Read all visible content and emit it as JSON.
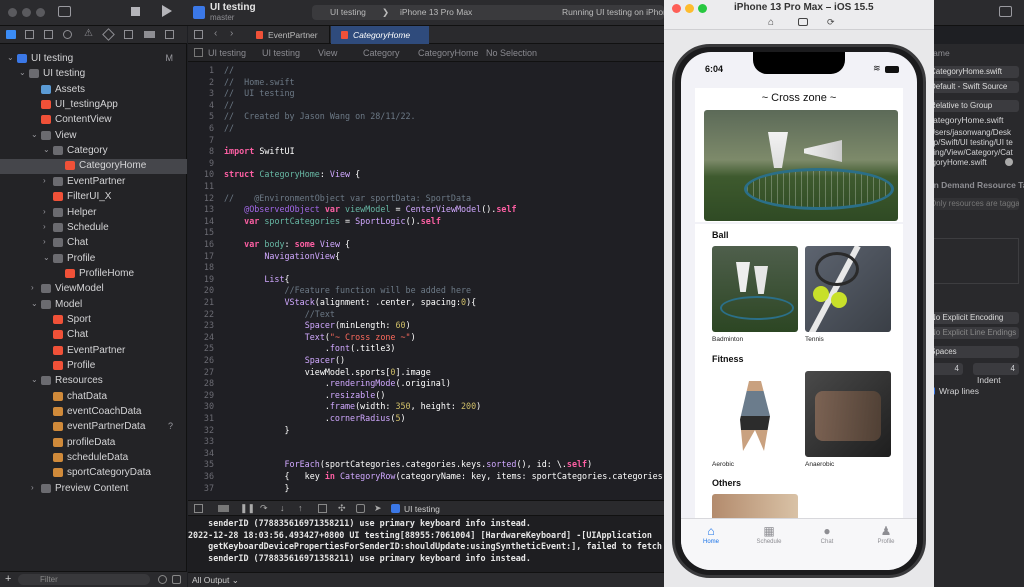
{
  "xcode": {
    "project": "UI testing",
    "scheme": "master",
    "breadcrumb_scheme": "UI testing",
    "device": "iPhone 13 Pro Max",
    "status": "Running UI testing on iPhone",
    "tabs": [
      "EventPartner",
      "CategoryHome"
    ],
    "jump_bar": [
      "UI testing",
      "UI testing",
      "View",
      "Category",
      "CategoryHome",
      "No Selection"
    ],
    "navigator": [
      {
        "label": "UI testing",
        "depth": 0,
        "chev": "open",
        "kind": "project",
        "badge": "M"
      },
      {
        "label": "UI testing",
        "depth": 1,
        "chev": "open",
        "kind": "folder"
      },
      {
        "label": "Assets",
        "depth": 2,
        "chev": "",
        "kind": "asset"
      },
      {
        "label": "UI_testingApp",
        "depth": 2,
        "chev": "",
        "kind": "swift"
      },
      {
        "label": "ContentView",
        "depth": 2,
        "chev": "",
        "kind": "swift"
      },
      {
        "label": "View",
        "depth": 2,
        "chev": "open",
        "kind": "folder"
      },
      {
        "label": "Category",
        "depth": 3,
        "chev": "open",
        "kind": "folder"
      },
      {
        "label": "CategoryHome",
        "depth": 4,
        "chev": "",
        "kind": "swift",
        "selected": true
      },
      {
        "label": "EventPartner",
        "depth": 3,
        "chev": "closed",
        "kind": "folder"
      },
      {
        "label": "FilterUI_X",
        "depth": 3,
        "chev": "",
        "kind": "swift"
      },
      {
        "label": "Helper",
        "depth": 3,
        "chev": "closed",
        "kind": "folder"
      },
      {
        "label": "Schedule",
        "depth": 3,
        "chev": "closed",
        "kind": "folder"
      },
      {
        "label": "Chat",
        "depth": 3,
        "chev": "closed",
        "kind": "folder"
      },
      {
        "label": "Profile",
        "depth": 3,
        "chev": "open",
        "kind": "folder"
      },
      {
        "label": "ProfileHome",
        "depth": 4,
        "chev": "",
        "kind": "swift"
      },
      {
        "label": "ViewModel",
        "depth": 2,
        "chev": "closed",
        "kind": "folder"
      },
      {
        "label": "Model",
        "depth": 2,
        "chev": "open",
        "kind": "folder"
      },
      {
        "label": "Sport",
        "depth": 3,
        "chev": "",
        "kind": "swift"
      },
      {
        "label": "Chat",
        "depth": 3,
        "chev": "",
        "kind": "swift"
      },
      {
        "label": "EventPartner",
        "depth": 3,
        "chev": "",
        "kind": "swift"
      },
      {
        "label": "Profile",
        "depth": 3,
        "chev": "",
        "kind": "swift"
      },
      {
        "label": "Resources",
        "depth": 2,
        "chev": "open",
        "kind": "folder"
      },
      {
        "label": "chatData",
        "depth": 3,
        "chev": "",
        "kind": "data"
      },
      {
        "label": "eventCoachData",
        "depth": 3,
        "chev": "",
        "kind": "data"
      },
      {
        "label": "eventPartnerData",
        "depth": 3,
        "chev": "",
        "kind": "data",
        "badge": "?"
      },
      {
        "label": "profileData",
        "depth": 3,
        "chev": "",
        "kind": "data"
      },
      {
        "label": "scheduleData",
        "depth": 3,
        "chev": "",
        "kind": "data"
      },
      {
        "label": "sportCategoryData",
        "depth": 3,
        "chev": "",
        "kind": "data"
      },
      {
        "label": "Preview Content",
        "depth": 2,
        "chev": "closed",
        "kind": "folder"
      }
    ],
    "filter_placeholder": "Filter",
    "output_label": "All Output",
    "console_target": "UI testing",
    "code_lines": [
      {
        "n": "1",
        "html": "<span class='c'>//</span>"
      },
      {
        "n": "2",
        "html": "<span class='c'>//  Home.swift</span>"
      },
      {
        "n": "3",
        "html": "<span class='c'>//  UI testing</span>"
      },
      {
        "n": "4",
        "html": "<span class='c'>//</span>"
      },
      {
        "n": "5",
        "html": "<span class='c'>//  Created by Jason Wang on 28/11/22.</span>"
      },
      {
        "n": "6",
        "html": "<span class='c'>//</span>"
      },
      {
        "n": "7",
        "html": ""
      },
      {
        "n": "8",
        "html": "<span class='k'>import</span> <span class='p'>SwiftUI</span>"
      },
      {
        "n": "9",
        "html": ""
      },
      {
        "n": "10",
        "html": "<span class='k'>struct</span> <span class='f'>CategoryHome</span><span class='p'>: </span><span class='t'>View</span><span class='p'> {</span>"
      },
      {
        "n": "11",
        "html": ""
      },
      {
        "n": "12",
        "html": "<span class='c'>//    @EnvironmentObject var sportData: SportData</span>"
      },
      {
        "n": "13",
        "html": "    <span class='m'>@ObservedObject</span> <span class='k'>var</span> <span class='f'>viewModel</span><span class='p'> = </span><span class='t'>CenterViewModel</span><span class='p'>().</span><span class='k'>self</span>"
      },
      {
        "n": "14",
        "html": "    <span class='k'>var</span> <span class='f'>sportCategories</span><span class='p'> = </span><span class='t'>SportLogic</span><span class='p'>().</span><span class='k'>self</span>"
      },
      {
        "n": "15",
        "html": ""
      },
      {
        "n": "16",
        "html": "    <span class='k'>var</span> <span class='f'>body</span><span class='p'>: </span><span class='k'>some</span> <span class='t'>View</span><span class='p'> {</span>"
      },
      {
        "n": "17",
        "html": "        <span class='t'>NavigationView</span><span class='p'>{</span>"
      },
      {
        "n": "18",
        "html": ""
      },
      {
        "n": "19",
        "html": "        <span class='t'>List</span><span class='p'>{</span>"
      },
      {
        "n": "20",
        "html": "            <span class='c'>//Feature function will be added here</span>"
      },
      {
        "n": "21",
        "html": "            <span class='t'>VStack</span><span class='p'>(alignment: .center, spacing:</span><span class='n'>0</span><span class='p'>){</span>"
      },
      {
        "n": "22",
        "html": "                <span class='c'>//Text</span>"
      },
      {
        "n": "23",
        "html": "                <span class='t'>Spacer</span><span class='p'>(minLength: </span><span class='n'>60</span><span class='p'>)</span>"
      },
      {
        "n": "24",
        "html": "                <span class='t'>Text</span><span class='p'>(</span><span class='s'>\"~ Cross zone ~\"</span><span class='p'>)</span>"
      },
      {
        "n": "25",
        "html": "                    <span class='p'>.</span><span class='t'>font</span><span class='p'>(.title3)</span>"
      },
      {
        "n": "26",
        "html": "                <span class='t'>Spacer</span><span class='p'>()</span>"
      },
      {
        "n": "27",
        "html": "                <span class='p'>viewModel.sports[</span><span class='n'>0</span><span class='p'>].image</span>"
      },
      {
        "n": "28",
        "html": "                    <span class='p'>.</span><span class='t'>renderingMode</span><span class='p'>(.original)</span>"
      },
      {
        "n": "29",
        "html": "                    <span class='p'>.</span><span class='t'>resizable</span><span class='p'>()</span>"
      },
      {
        "n": "30",
        "html": "                    <span class='p'>.</span><span class='t'>frame</span><span class='p'>(width: </span><span class='n'>350</span><span class='p'>, height: </span><span class='n'>200</span><span class='p'>)</span>"
      },
      {
        "n": "31",
        "html": "                    <span class='p'>.</span><span class='t'>cornerRadius</span><span class='p'>(</span><span class='n'>5</span><span class='p'>)</span>"
      },
      {
        "n": "32",
        "html": "            <span class='p'>}</span>"
      },
      {
        "n": "33",
        "html": ""
      },
      {
        "n": "34",
        "html": ""
      },
      {
        "n": "35",
        "html": "            <span class='t'>ForEach</span><span class='p'>(sportCategories.categories.keys.</span><span class='t'>sorted</span><span class='p'>(), id: \\.</span><span class='k'>self</span><span class='p'>)</span>"
      },
      {
        "n": "36",
        "html": "            <span class='p'>{   key </span><span class='k'>in</span> <span class='t'>CategoryRow</span><span class='p'>(categoryName: key, items: sportCategories.categories</span>"
      },
      {
        "n": "37",
        "html": "            <span class='p'>}</span>"
      }
    ],
    "console_lines": [
      "    senderID (778835616971358211) use primary keyboard info instead.",
      "2022-12-28 18:03:56.493427+0800 UI testing[88955:7061004] [HardwareKeyboard] -[UIApplication",
      "    getKeyboardDevicePropertiesForSenderID:shouldUpdate:usingSyntheticEvent:], failed to fetch",
      "    senderID (778835616971358211) use primary keyboard info instead."
    ],
    "inspector": {
      "name_label": "Name",
      "file_name": "CategoryHome.swift",
      "type": "Default - Swift Source",
      "location": "Relative to Group",
      "file_rel": "CategoryHome.swift",
      "full_path": "/Users/jasonwang/Desktop/Swift/UI testing/UI testing/View/Category/CategoryHome.swift",
      "on_demand_title": "On Demand Resource Tags",
      "tags_placeholder": "Only resources are taggable",
      "encoding": "No Explicit Encoding",
      "line_endings": "No Explicit Line Endings",
      "indent_using": "Spaces",
      "widths": [
        "4",
        "4"
      ],
      "indent_label": "Indent",
      "wrap_lines": "Wrap lines"
    }
  },
  "simulator": {
    "title": "iPhone 13 Pro Max – iOS 15.5",
    "time": "6:04",
    "header": "~ Cross zone ~",
    "sections": [
      {
        "title": "Ball",
        "items": [
          "Badminton",
          "Tennis"
        ]
      },
      {
        "title": "Fitness",
        "items": [
          "Aerobic",
          "Anaerobic"
        ]
      },
      {
        "title": "Others",
        "items": []
      }
    ],
    "tabs": [
      {
        "label": "Home",
        "active": true
      },
      {
        "label": "Schedule",
        "active": false
      },
      {
        "label": "Chat",
        "active": false
      },
      {
        "label": "Profile",
        "active": false
      }
    ]
  }
}
